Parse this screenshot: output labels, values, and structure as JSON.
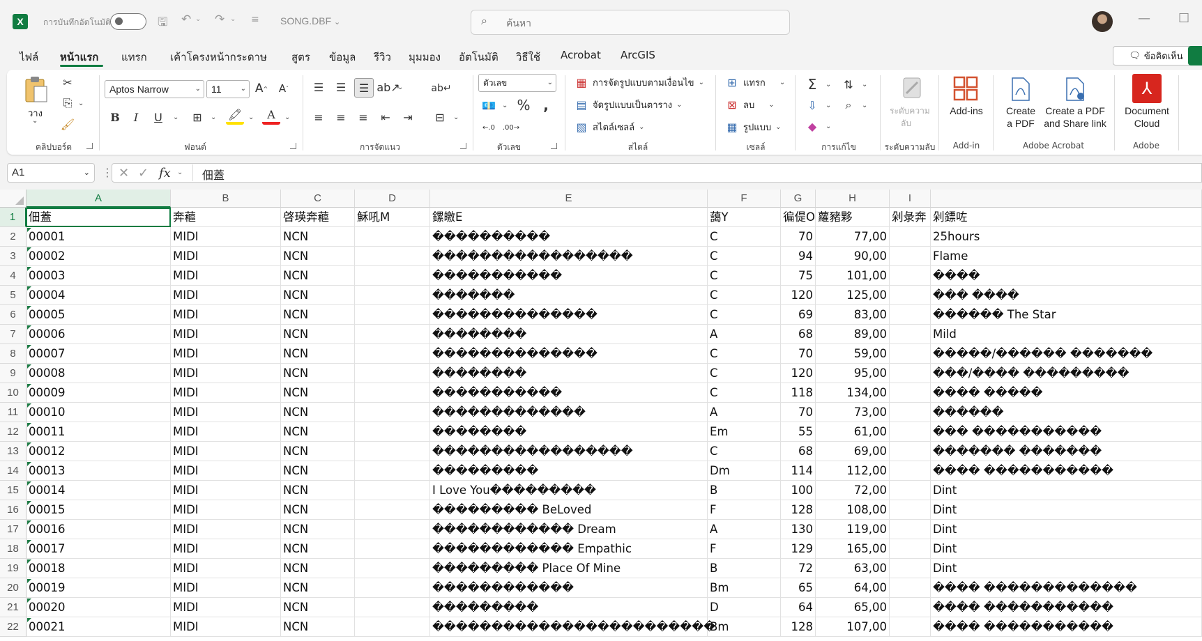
{
  "titlebar": {
    "autosave_label": "การบันทึกอัตโนมัติ",
    "filename": "SONG.DBF",
    "search_placeholder": "ค้นหา",
    "app_letter": "X"
  },
  "tabs": [
    "ไฟล์",
    "หน้าแรก",
    "แทรก",
    "เค้าโครงหน้ากระดาษ",
    "สูตร",
    "ข้อมูล",
    "รีวิว",
    "มุมมอง",
    "อัตโนมัติ",
    "วิธีใช้",
    "Acrobat",
    "ArcGIS"
  ],
  "active_tab": "หน้าแรก",
  "comments_label": "ข้อคิดเห็น",
  "ribbon": {
    "clipboard": {
      "paste_label": "วาง",
      "group": "คลิปบอร์ด"
    },
    "font": {
      "name": "Aptos Narrow",
      "size": "11",
      "group": "ฟอนต์"
    },
    "alignment": {
      "group": "การจัดแนว"
    },
    "number": {
      "format": "ตัวเลข",
      "group": "ตัวเลข"
    },
    "styles": {
      "cond_format": "การจัดรูปแบบตามเงื่อนไข",
      "format_table": "จัดรูปแบบเป็นตาราง",
      "cell_styles": "สไตล์เซลล์",
      "group": "สไตล์"
    },
    "cells": {
      "insert": "แทรก",
      "delete": "ลบ",
      "format": "รูปแบบ",
      "group": "เซลล์"
    },
    "editing": {
      "group": "การแก้ไข"
    },
    "sensitivity": {
      "label1": "ระดับความ",
      "label2": "ลับ",
      "group": "ระดับความลับ"
    },
    "addins": {
      "label": "Add-ins",
      "group": "Add-in"
    },
    "acrobat": {
      "create_pdf_1": "Create",
      "create_pdf_2": "a PDF",
      "share_1": "Create a PDF",
      "share_2": "and Share link",
      "group": "Adobe Acrobat"
    },
    "adobe": {
      "doc_cloud_1": "Document",
      "doc_cloud_2": "Cloud",
      "group": "Adobe"
    }
  },
  "formula_bar": {
    "namebox": "A1",
    "value": "佃蓋"
  },
  "colors": {
    "accent": "#107c41",
    "acrobat_red": "#d7261e"
  },
  "columns": [
    "A",
    "B",
    "C",
    "D",
    "E",
    "F",
    "G",
    "H",
    "I"
  ],
  "rows": [
    [
      "佃蓋",
      "奔藲",
      "啓瑛奔藲",
      "穌吼M",
      "鏍皦E",
      "藹Y",
      "徧偍O",
      "蘿豬夥",
      "剁彔奔",
      "剁鏢咗"
    ],
    [
      "00001",
      "MIDI",
      "NCN",
      "",
      "����������",
      "C",
      "70",
      "77,00",
      "",
      "25hours"
    ],
    [
      "00002",
      "MIDI",
      "NCN",
      "",
      "�����������������",
      "C",
      "94",
      "90,00",
      "",
      "Flame"
    ],
    [
      "00003",
      "MIDI",
      "NCN",
      "",
      "�����������",
      "C",
      "75",
      "101,00",
      "",
      "����"
    ],
    [
      "00004",
      "MIDI",
      "NCN",
      "",
      "�������",
      "C",
      "120",
      "125,00",
      "",
      "��� ����"
    ],
    [
      "00005",
      "MIDI",
      "NCN",
      "",
      "��������������",
      "C",
      "69",
      "83,00",
      "",
      "������ The Star"
    ],
    [
      "00006",
      "MIDI",
      "NCN",
      "",
      "��������",
      "A",
      "68",
      "89,00",
      "",
      "Mild"
    ],
    [
      "00007",
      "MIDI",
      "NCN",
      "",
      "��������������",
      "C",
      "70",
      "59,00",
      "",
      "�����/������ �������"
    ],
    [
      "00008",
      "MIDI",
      "NCN",
      "",
      "��������",
      "C",
      "120",
      "95,00",
      "",
      "���/���� ���������"
    ],
    [
      "00009",
      "MIDI",
      "NCN",
      "",
      "�����������",
      "C",
      "118",
      "134,00",
      "",
      "���� �����"
    ],
    [
      "00010",
      "MIDI",
      "NCN",
      "",
      "�������������",
      "A",
      "70",
      "73,00",
      "",
      "������"
    ],
    [
      "00011",
      "MIDI",
      "NCN",
      "",
      "��������",
      "Em",
      "55",
      "61,00",
      "",
      "��� �����������"
    ],
    [
      "00012",
      "MIDI",
      "NCN",
      "",
      "�����������������",
      "C",
      "68",
      "69,00",
      "",
      "������� �������"
    ],
    [
      "00013",
      "MIDI",
      "NCN",
      "",
      "���������",
      "Dm",
      "114",
      "112,00",
      "",
      "���� �����������"
    ],
    [
      "00014",
      "MIDI",
      "NCN",
      "",
      "I Love You���������",
      "B",
      "100",
      "72,00",
      "",
      "Dint"
    ],
    [
      "00015",
      "MIDI",
      "NCN",
      "",
      "��������� BeLoved",
      "F",
      "128",
      "108,00",
      "",
      "Dint"
    ],
    [
      "00016",
      "MIDI",
      "NCN",
      "",
      "������������ Dream",
      "A",
      "130",
      "119,00",
      "",
      "Dint"
    ],
    [
      "00017",
      "MIDI",
      "NCN",
      "",
      "������������ Empathic",
      "F",
      "129",
      "165,00",
      "",
      "Dint"
    ],
    [
      "00018",
      "MIDI",
      "NCN",
      "",
      "��������� Place Of Mine",
      "B",
      "72",
      "63,00",
      "",
      "Dint"
    ],
    [
      "00019",
      "MIDI",
      "NCN",
      "",
      "������������",
      "Bm",
      "65",
      "64,00",
      "",
      "���� �������������"
    ],
    [
      "00020",
      "MIDI",
      "NCN",
      "",
      "���������",
      "D",
      "64",
      "65,00",
      "",
      "���� �����������"
    ],
    [
      "00021",
      "MIDI",
      "NCN",
      "",
      "������������������������",
      "Bm",
      "128",
      "107,00",
      "",
      "���� �����������"
    ]
  ]
}
